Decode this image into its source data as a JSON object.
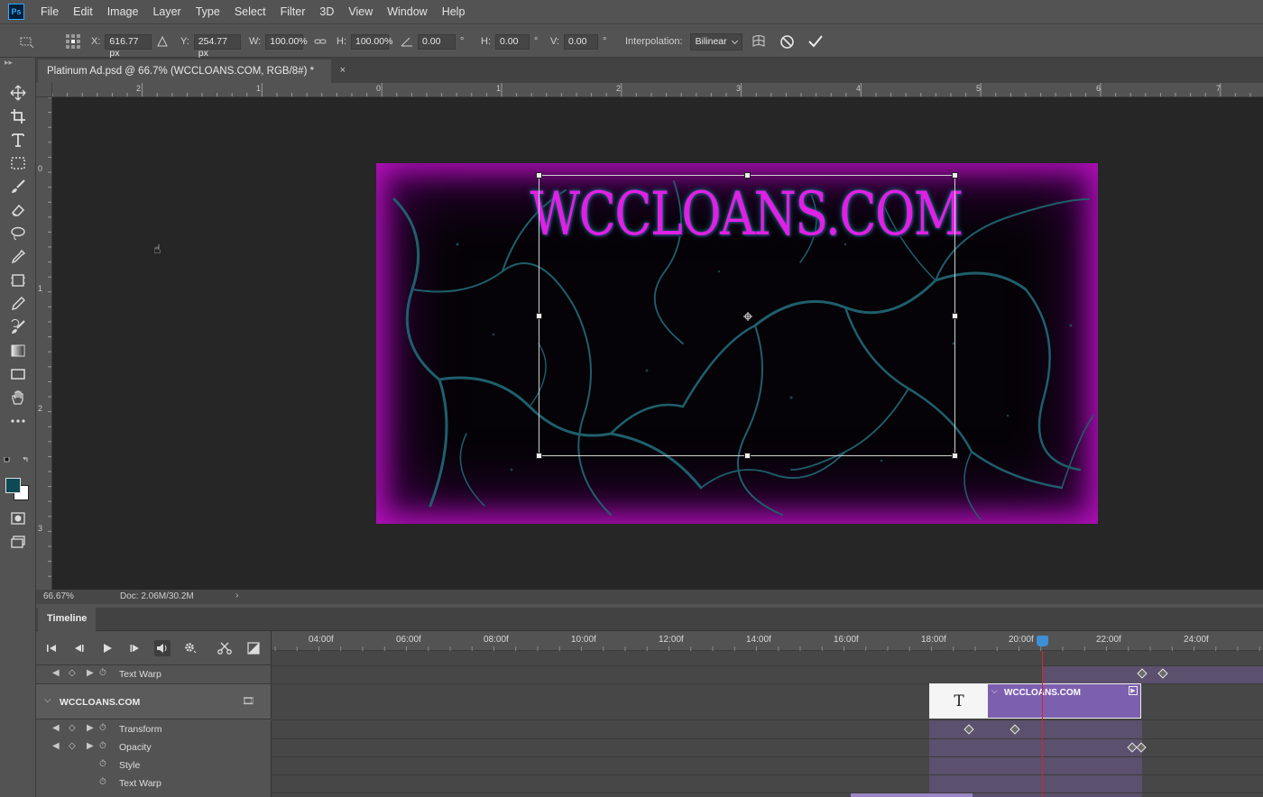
{
  "app": {
    "logo": "Ps"
  },
  "menu": [
    "File",
    "Edit",
    "Image",
    "Layer",
    "Type",
    "Select",
    "Filter",
    "3D",
    "View",
    "Window",
    "Help"
  ],
  "options": {
    "x_label": "X:",
    "x_value": "616.77 px",
    "y_label": "Y:",
    "y_value": "254.77 px",
    "w_label": "W:",
    "w_value": "100.00%",
    "h_label": "H:",
    "h_value": "100.00%",
    "angle_value": "0.00",
    "angle_unit": "°",
    "hskew_label": "H:",
    "hskew_value": "0.00",
    "hskew_unit": "°",
    "vskew_label": "V:",
    "vskew_value": "0.00",
    "vskew_unit": "°",
    "interpolation_label": "Interpolation:",
    "interpolation_value": "Bilinear"
  },
  "document": {
    "tab_title": "Platinum Ad.psd @ 66.7% (WCCLOANS.COM, RGB/8#) *",
    "close": "×",
    "headline": "WCCLOANS.COM"
  },
  "rulers": {
    "h": [
      "2",
      "1",
      "0",
      "1",
      "2",
      "3",
      "4",
      "5",
      "6",
      "7"
    ],
    "v": [
      "0",
      "1",
      "2",
      "3"
    ]
  },
  "status": {
    "zoom": "66.67%",
    "doc": "Doc: 2.06M/30.2M",
    "arrow": "›"
  },
  "timeline": {
    "tab": "Timeline",
    "ticks": [
      "04:00f",
      "06:00f",
      "08:00f",
      "10:00f",
      "12:00f",
      "14:00f",
      "16:00f",
      "18:00f",
      "20:00f",
      "22:00f",
      "24:00f"
    ],
    "top_row_label": "Text Warp",
    "layer_name": "WCCLOANS.COM",
    "properties": [
      "Transform",
      "Opacity",
      "Style",
      "Text Warp"
    ],
    "clip_name": "WCCLOANS.COM",
    "clip_icon": "T"
  },
  "colors": {
    "accent": "#e020e6",
    "crack": "#1f5f6c",
    "foreground_swatch": "#0e4a56",
    "playhead": "#d8232a"
  }
}
